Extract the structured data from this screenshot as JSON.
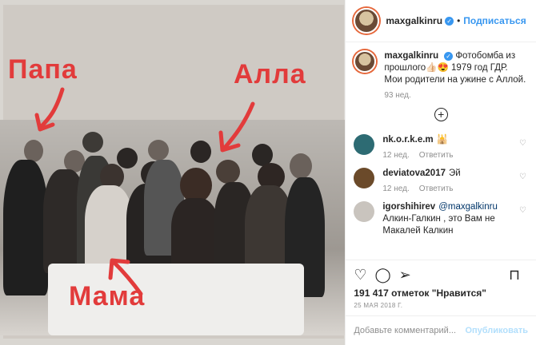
{
  "photo": {
    "labels": {
      "papa": "Папа",
      "alla": "Алла",
      "mama": "Мама"
    }
  },
  "header": {
    "username": "maxgalkinru",
    "follow_label": "Подписаться"
  },
  "caption": {
    "username": "maxgalkinru",
    "text": "Фотобомба из прошлого👍🏻😍 1979 год ГДР. Мои родители на ужине с Аллой.",
    "time": "93 нед."
  },
  "comments": [
    {
      "username": "nk.o.r.k.e.m",
      "text": "🕌",
      "time": "12 нед.",
      "reply": "Ответить"
    },
    {
      "username": "deviatova2017",
      "text": "Эй",
      "time": "12 нед.",
      "reply": "Ответить"
    },
    {
      "username": "igorshihirev",
      "mention": "@maxgalkinru",
      "text": "Алкин-Галкин , это Вам не Макалей Калкин",
      "time": "",
      "reply": ""
    }
  ],
  "likes": "191 417 отметок \"Нравится\"",
  "date": "25 МАЯ 2018 Г.",
  "add_comment": {
    "placeholder": "Добавьте комментарий...",
    "publish": "Опубликовать"
  },
  "icons": {
    "like": "heart-icon",
    "comment": "comment-icon",
    "share": "share-icon",
    "save": "bookmark-icon",
    "more": "more-icon"
  }
}
